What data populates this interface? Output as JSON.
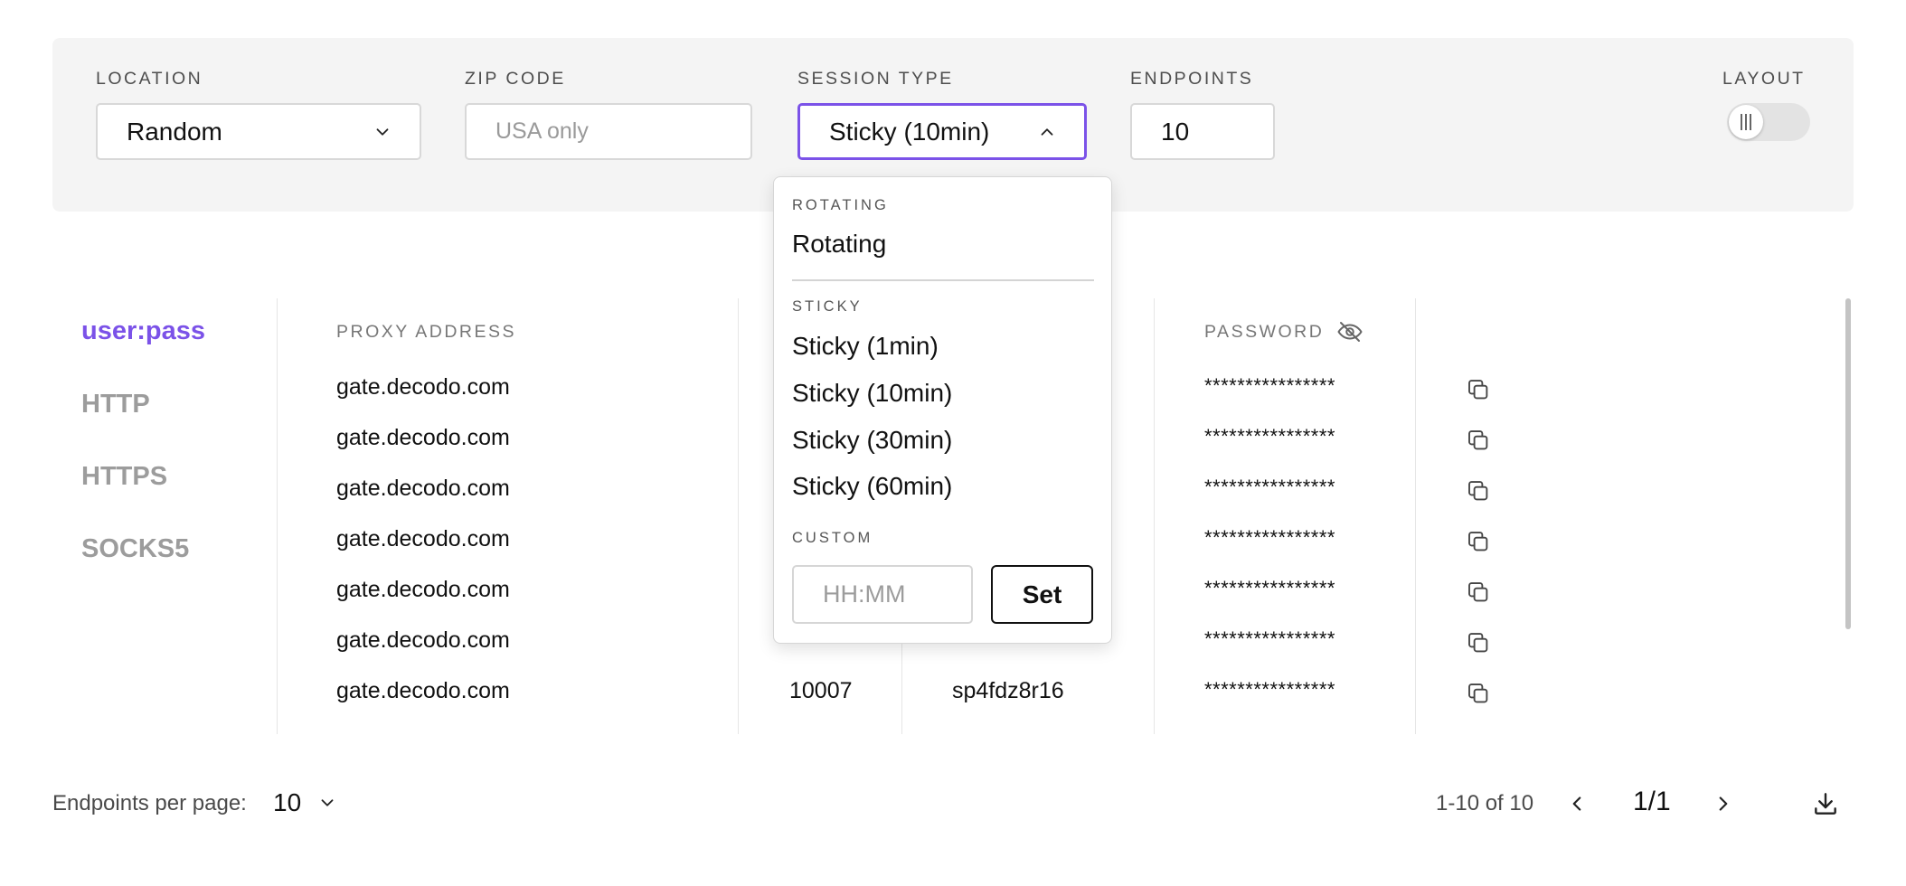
{
  "filters": {
    "location": {
      "label": "LOCATION",
      "value": "Random"
    },
    "zip_code": {
      "label": "ZIP CODE",
      "placeholder": "USA only"
    },
    "session_type": {
      "label": "SESSION TYPE",
      "value": "Sticky (10min)"
    },
    "endpoints": {
      "label": "ENDPOINTS",
      "value": "10"
    },
    "layout": {
      "label": "LAYOUT"
    }
  },
  "session_dropdown": {
    "rotating_header": "ROTATING",
    "rotating_option": "Rotating",
    "sticky_header": "STICKY",
    "sticky_options": [
      "Sticky (1min)",
      "Sticky (10min)",
      "Sticky (30min)",
      "Sticky (60min)"
    ],
    "custom_header": "CUSTOM",
    "custom_placeholder": "HH:MM",
    "set_label": "Set"
  },
  "protocols": [
    "user:pass",
    "HTTP",
    "HTTPS",
    "SOCKS5"
  ],
  "active_protocol": "user:pass",
  "table": {
    "headers": {
      "proxy_address": "PROXY ADDRESS",
      "password": "PASSWORD"
    },
    "rows": [
      {
        "address": "gate.decodo.com",
        "port": "",
        "username": "",
        "password": "****************"
      },
      {
        "address": "gate.decodo.com",
        "port": "",
        "username": "",
        "password": "****************"
      },
      {
        "address": "gate.decodo.com",
        "port": "",
        "username": "",
        "password": "****************"
      },
      {
        "address": "gate.decodo.com",
        "port": "",
        "username": "",
        "password": "****************"
      },
      {
        "address": "gate.decodo.com",
        "port": "",
        "username": "",
        "password": "****************"
      },
      {
        "address": "gate.decodo.com",
        "port": "",
        "username": "",
        "password": "****************"
      },
      {
        "address": "gate.decodo.com",
        "port": "10007",
        "username": "sp4fdz8r16",
        "password": "****************"
      }
    ]
  },
  "footer": {
    "per_page_label": "Endpoints per page:",
    "per_page_value": "10",
    "range_text": "1-10 of 10",
    "page_indicator": "1/1"
  },
  "colors": {
    "accent": "#7b52e8",
    "panel_bg": "#f4f4f4"
  }
}
